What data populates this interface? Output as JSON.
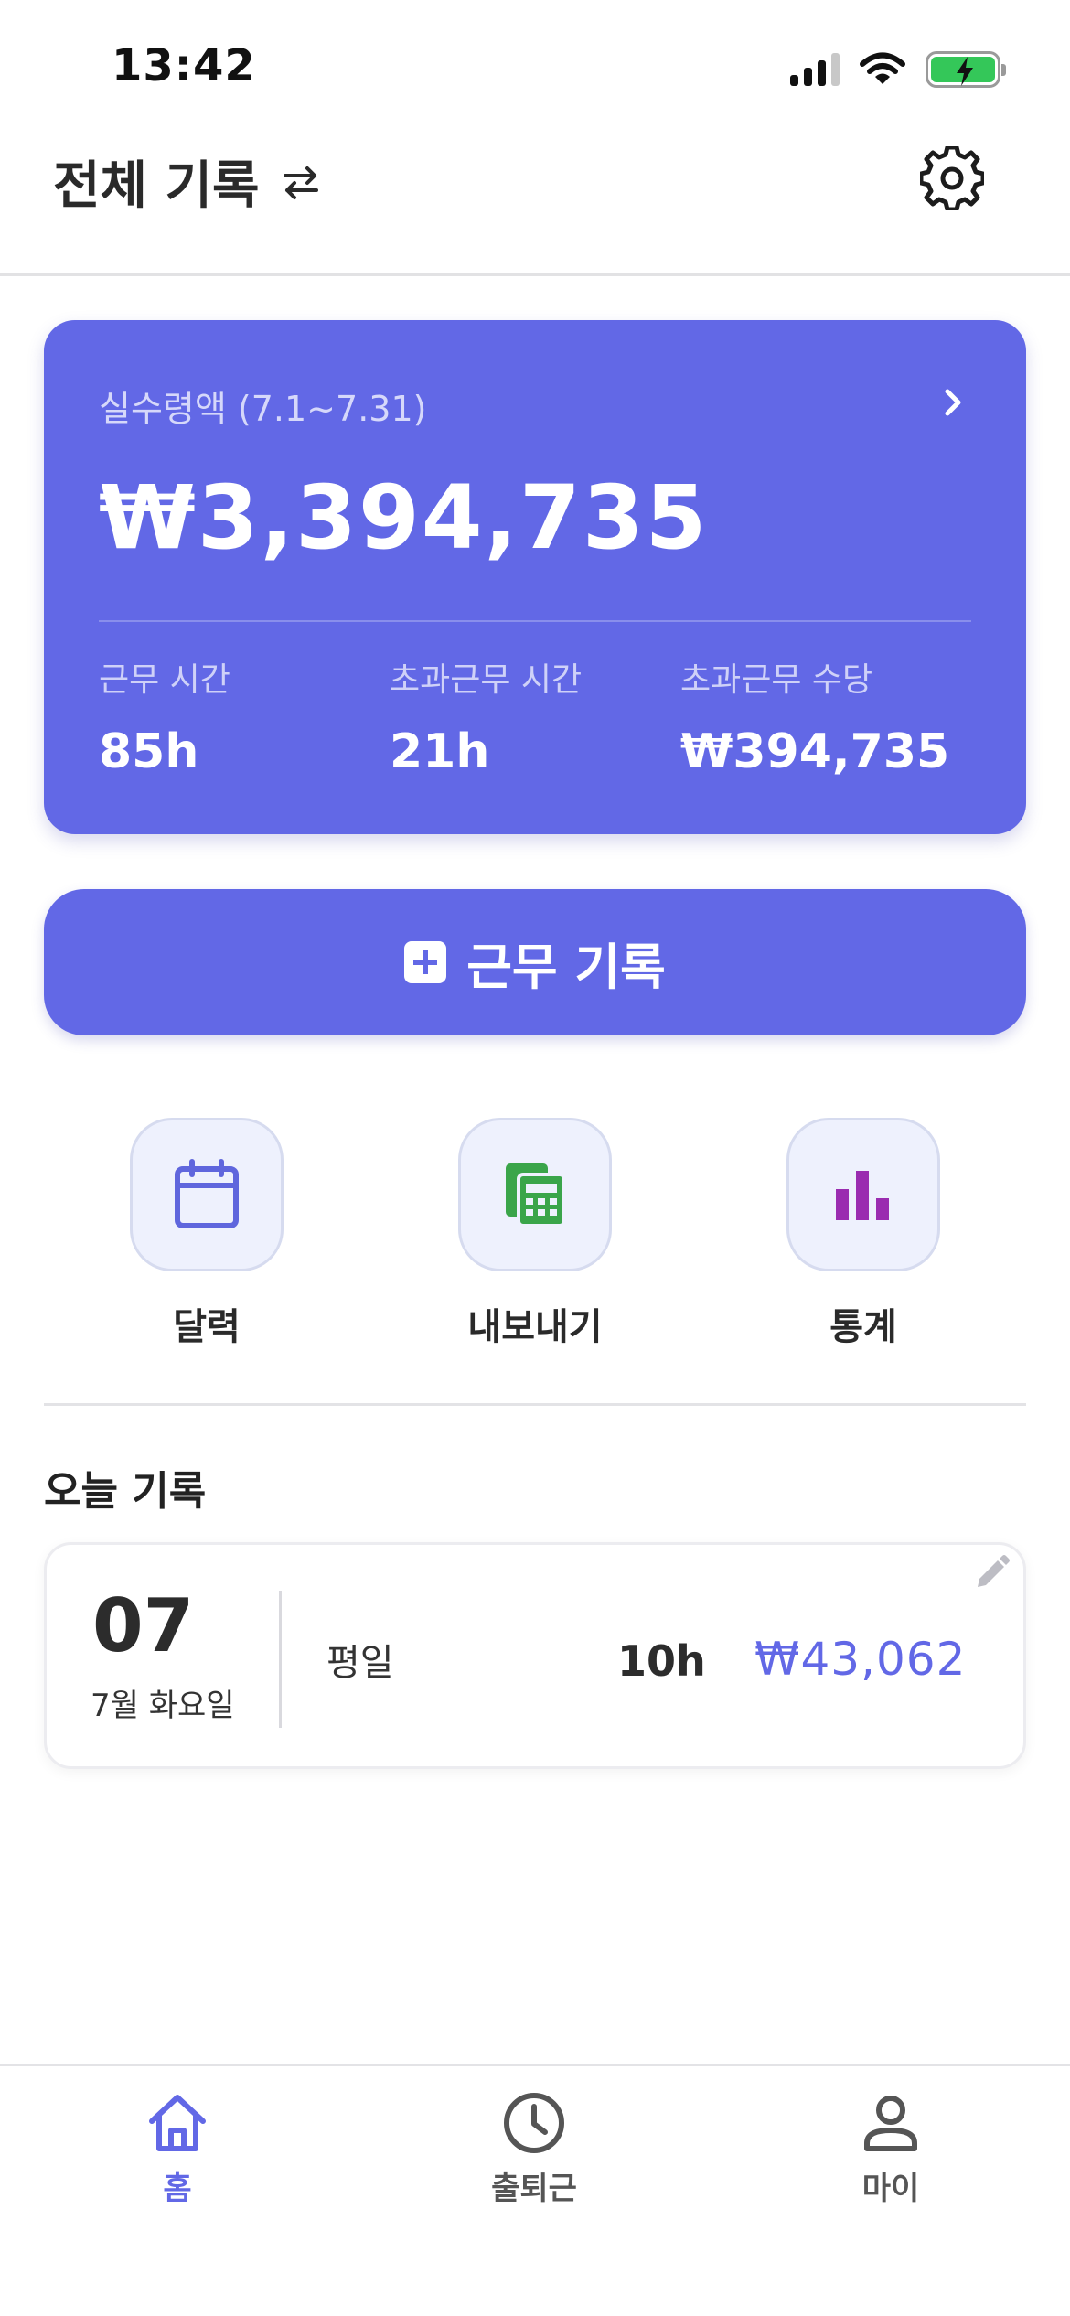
{
  "status_bar": {
    "time": "13:42"
  },
  "header": {
    "title": "전체 기록"
  },
  "summary": {
    "label": "실수령액 (7.1~7.31)",
    "amount": "₩3,394,735",
    "stats": [
      {
        "label": "근무 시간",
        "value": "85h"
      },
      {
        "label": "초과근무 시간",
        "value": "21h"
      },
      {
        "label": "초과근무 수당",
        "value": "₩394,735"
      }
    ]
  },
  "record_button": {
    "label": "근무 기록"
  },
  "quick_actions": [
    {
      "label": "달력",
      "icon": "calendar-icon",
      "color": "#5f66dd"
    },
    {
      "label": "내보내기",
      "icon": "spreadsheet-icon",
      "color": "#3aa54a"
    },
    {
      "label": "통계",
      "icon": "bar-chart-icon",
      "color": "#9a2cb0"
    }
  ],
  "today": {
    "title": "오늘 기록",
    "day": "07",
    "weekday": "7월 화요일",
    "type": "평일",
    "hours": "10h",
    "pay": "₩43,062"
  },
  "bottom_nav": [
    {
      "label": "홈",
      "icon": "home-icon",
      "active": true
    },
    {
      "label": "출퇴근",
      "icon": "clock-icon",
      "active": false
    },
    {
      "label": "마이",
      "icon": "user-icon",
      "active": false
    }
  ],
  "colors": {
    "accent": "#6268e6",
    "battery": "#34c759"
  }
}
